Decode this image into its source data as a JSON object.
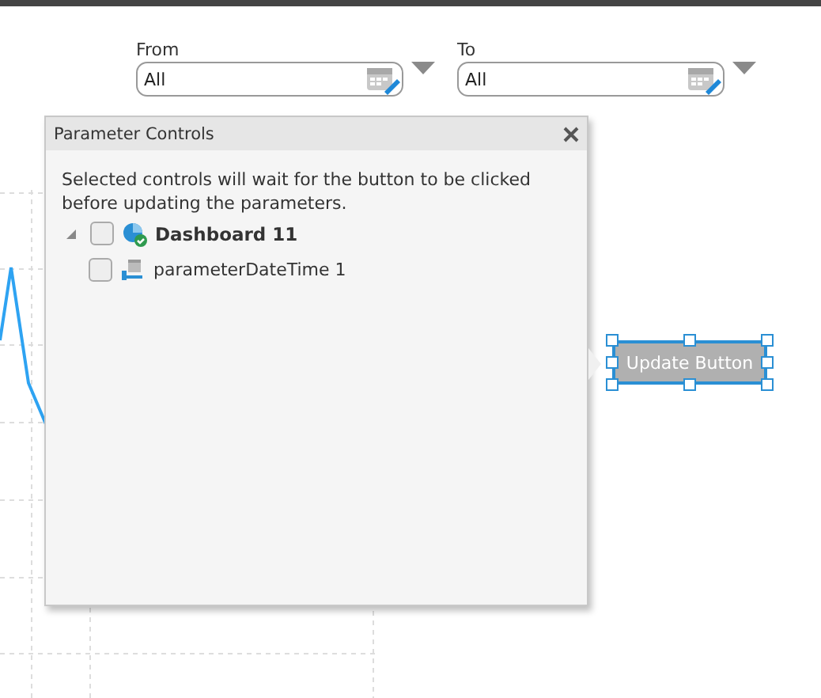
{
  "filters": [
    {
      "label": "From",
      "value": "All"
    },
    {
      "label": "To",
      "value": "All"
    }
  ],
  "dialog": {
    "title": "Parameter Controls",
    "description": "Selected controls will wait for the button to be clicked before updating the parameters.",
    "tree": [
      {
        "label": "Dashboard 11",
        "kind": "dashboard",
        "checked": false,
        "expanded": true,
        "children": [
          {
            "label": "parameterDateTime 1",
            "kind": "parameter",
            "checked": false
          }
        ]
      }
    ]
  },
  "canvas_button": {
    "label": "Update Button",
    "selected": true
  }
}
